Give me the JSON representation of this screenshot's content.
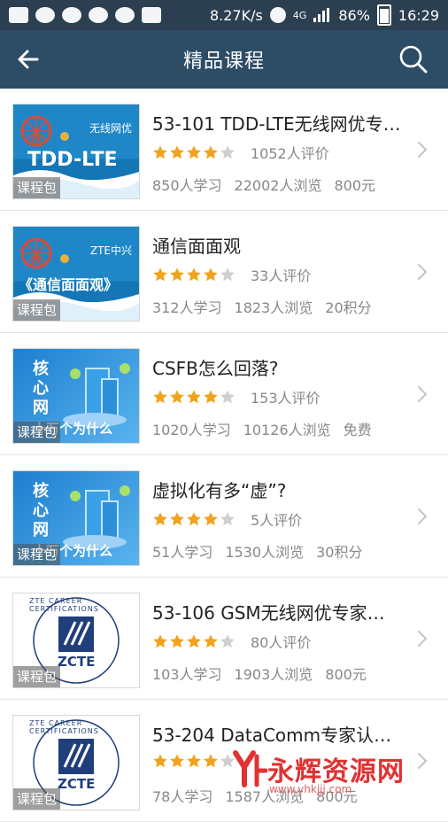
{
  "status_bar": {
    "network_speed": "8.27K/s",
    "net_type": "4G",
    "battery": "86%",
    "time": "16:29"
  },
  "app_bar": {
    "title": "精品课程",
    "back_icon": "back-arrow-icon",
    "search_icon": "search-icon"
  },
  "courses": [
    {
      "title": "53-101 TDD-LTE无线网优专…",
      "reviews": "1052人评价",
      "learners": "850人学习",
      "views": "22002人浏览",
      "price": "800元",
      "stars": 4,
      "tag": "课程包",
      "thumb_title": "TDD-LTE",
      "thumb_sub": "无线网优"
    },
    {
      "title": "通信面面观",
      "reviews": "33人评价",
      "learners": "312人学习",
      "views": "1823人浏览",
      "price": "20积分",
      "stars": 4,
      "tag": "课程包",
      "thumb_title": "《通信面面观》",
      "thumb_sub": "ZTE中兴"
    },
    {
      "title": "CSFB怎么回落?",
      "reviews": "153人评价",
      "learners": "1020人学习",
      "views": "10126人浏览",
      "price": "免费",
      "stars": 4,
      "tag": "课程包",
      "thumb_title": "核心网",
      "thumb_sub": "十万个为什么"
    },
    {
      "title": "虚拟化有多“虚”?",
      "reviews": "5人评价",
      "learners": "51人学习",
      "views": "1530人浏览",
      "price": "30积分",
      "stars": 4,
      "tag": "课程包",
      "thumb_title": "核心网",
      "thumb_sub": "十万个为什么"
    },
    {
      "title": "53-106 GSM无线网优专家…",
      "reviews": "80人评价",
      "learners": "103人学习",
      "views": "1903人浏览",
      "price": "800元",
      "stars": 4,
      "tag": "课程包",
      "thumb_title": "ZCTE",
      "thumb_sub": "ZTE CAREER CERTIFICATIONS"
    },
    {
      "title": "53-204 DataComm专家认…",
      "reviews": "",
      "learners": "78人学习",
      "views": "1587人浏览",
      "price": "800元",
      "stars": 4,
      "tag": "课程包",
      "thumb_title": "ZCTE",
      "thumb_sub": "ZTE CAREER CERTIFICATIONS"
    }
  ],
  "watermark": {
    "text": "永辉资源网",
    "url": "www.yhkjjj.com"
  },
  "colors": {
    "status_bar": "#2c3f50",
    "app_bar": "#2d4c66",
    "star": "#f0a31c",
    "star_empty": "#cfcfcf",
    "watermark": "#e03232"
  }
}
